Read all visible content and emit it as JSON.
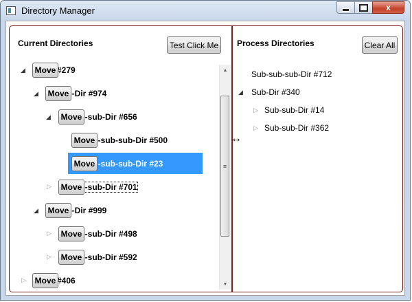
{
  "window": {
    "title": "Directory Manager",
    "close_glyph": "x"
  },
  "left_panel": {
    "title": "Current Directories",
    "test_button_label": "Test Click Me",
    "move_label": "Move",
    "nodes": [
      {
        "label": "Dir #279",
        "checkbox": "partial",
        "expanded": true
      },
      {
        "label": "Sub-Dir #974",
        "checkbox": "partial",
        "expanded": true
      },
      {
        "label": "Sub-sub-Dir #656",
        "checkbox": "partial",
        "expanded": true
      },
      {
        "label": "Sub-sub-sub-Dir #500",
        "checkbox": "unchecked"
      },
      {
        "label": "Sub-sub-sub-Dir #23",
        "checkbox": "checked",
        "selected": true
      },
      {
        "label": "Sub-sub-Dir #701",
        "checkbox": "unchecked",
        "expanded": false,
        "focused": true
      },
      {
        "label": "Sub-Dir #999",
        "checkbox": "checked",
        "expanded": true
      },
      {
        "label": "Sub-sub-Dir #498",
        "checkbox": "checked",
        "expanded": false
      },
      {
        "label": "Sub-sub-Dir #592",
        "checkbox": "checked",
        "expanded": false
      },
      {
        "label": "Dir #406",
        "checkbox": "unchecked",
        "expanded": false
      }
    ]
  },
  "right_panel": {
    "title": "Process Directories",
    "clear_button_label": "Clear All",
    "nodes": [
      {
        "label": "Sub-sub-sub-Dir #712"
      },
      {
        "label": "Sub-Dir #340",
        "expanded": true
      },
      {
        "label": "Sub-sub-Dir #14",
        "expanded": false
      },
      {
        "label": "Sub-sub-Dir #362",
        "expanded": false
      }
    ]
  },
  "colors": {
    "accent_selection": "#3399ff",
    "frame_border": "#7a1a1a"
  }
}
